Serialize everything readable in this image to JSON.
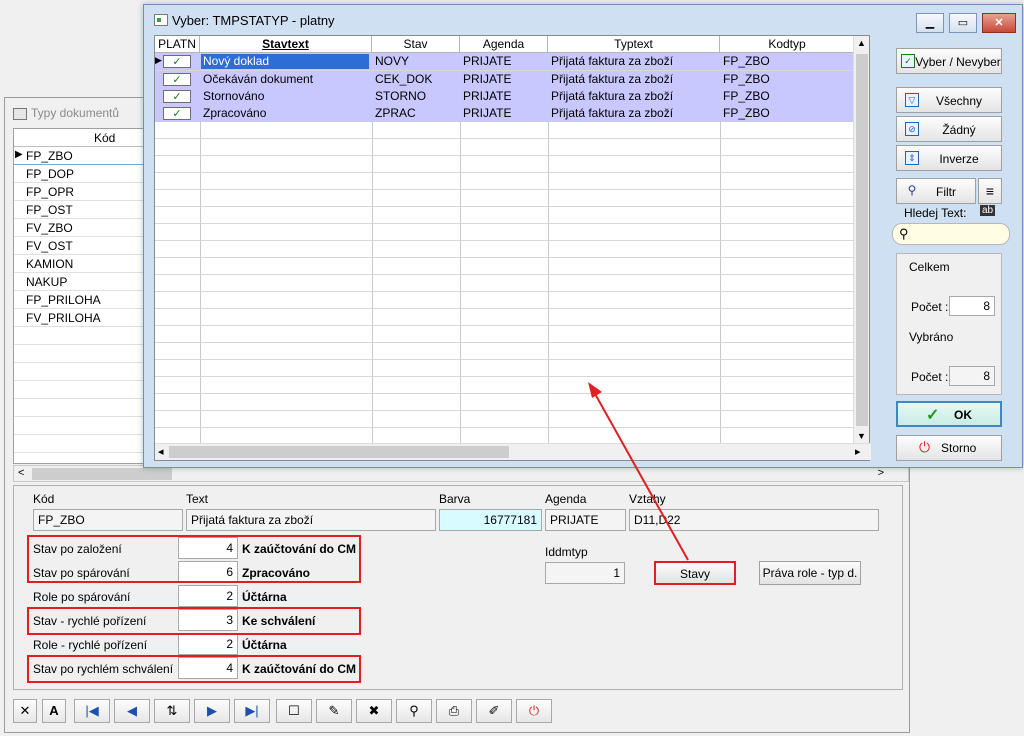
{
  "back_window": {
    "title": "Typy dokumentů",
    "grid_header": "Kód",
    "rows": [
      "FP_ZBO",
      "FP_DOP",
      "FP_OPR",
      "FP_OST",
      "FV_ZBO",
      "FV_OST",
      "KAMION",
      "NAKUP",
      "FP_PRILOHA",
      "FV_PRILOHA"
    ],
    "scroll_left": "<",
    "scroll_right": ">"
  },
  "detail": {
    "kod_label": "Kód",
    "kod_value": "FP_ZBO",
    "text_label": "Text",
    "text_value": "Přijatá faktura za zboží",
    "barva_label": "Barva",
    "barva_value": "16777181",
    "agenda_label": "Agenda",
    "agenda_value": "PRIJATE",
    "vztahy_label": "Vztahy",
    "vztahy_value": "D11,D22",
    "iddmtyp_label": "Iddmtyp",
    "iddmtyp_value": "1",
    "fields": [
      {
        "label": "Stav po založení",
        "value": "4",
        "desc": "K zaúčtování do CM"
      },
      {
        "label": "Stav po spárování",
        "value": "6",
        "desc": "Zpracováno"
      },
      {
        "label": "Role po spárování",
        "value": "2",
        "desc": "Účtárna"
      },
      {
        "label": "Stav - rychlé pořízení",
        "value": "3",
        "desc": "Ke schválení"
      },
      {
        "label": "Role - rychlé pořízení",
        "value": "2",
        "desc": "Účtárna"
      },
      {
        "label": "Stav po rychlém schválení",
        "value": "4",
        "desc": "K zaúčtování do CM"
      }
    ],
    "stavy_button": "Stavy",
    "prava_button": "Práva role - typ d."
  },
  "dialog": {
    "title": "Vyber: TMPSTATYP - platny",
    "columns": [
      "PLATN",
      "Stavtext",
      "Stav",
      "Agenda",
      "Typtext",
      "Kodtyp"
    ],
    "rows": [
      {
        "check": "✓",
        "stavtext": "Nový doklad",
        "stav": "NOVY",
        "agenda": "PRIJATE",
        "typtext": "Přijatá faktura za zboží",
        "kodtyp": "FP_ZBO"
      },
      {
        "check": "✓",
        "stavtext": "Očekáván dokument",
        "stav": "CEK_DOK",
        "agenda": "PRIJATE",
        "typtext": "Přijatá faktura za zboží",
        "kodtyp": "FP_ZBO"
      },
      {
        "check": "✓",
        "stavtext": "Stornováno",
        "stav": "STORNO",
        "agenda": "PRIJATE",
        "typtext": "Přijatá faktura za zboží",
        "kodtyp": "FP_ZBO"
      },
      {
        "check": "✓",
        "stavtext": "Zpracováno",
        "stav": "ZPRAC",
        "agenda": "PRIJATE",
        "typtext": "Přijatá faktura za zboží",
        "kodtyp": "FP_ZBO"
      }
    ],
    "vyber_button": "Vyber / Nevyber",
    "vsechny_button": "Všechny",
    "zadny_button": "Žádný",
    "inverze_button": "Inverze",
    "filtr_button": "Filtr",
    "hledej_label": "Hledej Text:",
    "celkem_label": "Celkem",
    "pocet_label": "Počet :",
    "celkem_pocet": "8",
    "vybrano_label": "Vybráno",
    "vybrano_pocet": "8",
    "ok_button": "OK",
    "storno_button": "Storno"
  },
  "colors": {
    "accent": "#2c6dd6",
    "selection": "#c8c8ff",
    "highlight_red": "#e02020"
  }
}
